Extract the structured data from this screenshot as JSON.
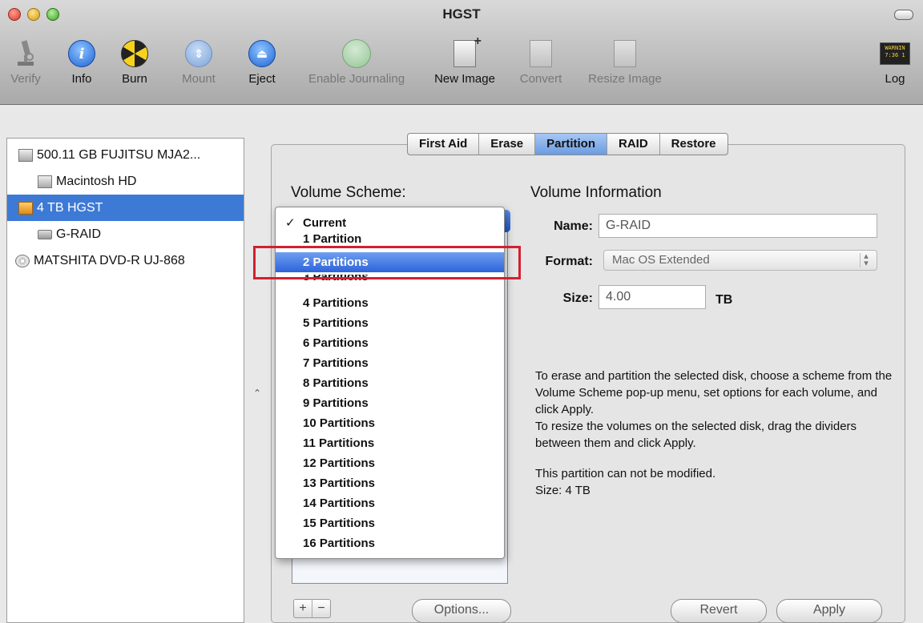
{
  "window": {
    "title": "HGST"
  },
  "toolbar": {
    "items": [
      {
        "label": "Verify",
        "icon": "microscope-icon",
        "enabled": false
      },
      {
        "label": "Info",
        "icon": "info-icon",
        "enabled": true
      },
      {
        "label": "Burn",
        "icon": "burn-icon",
        "enabled": true
      },
      {
        "label": "Mount",
        "icon": "mount-icon",
        "enabled": false
      },
      {
        "label": "Eject",
        "icon": "eject-icon",
        "enabled": true
      },
      {
        "label": "Enable Journaling",
        "icon": "journaling-icon",
        "enabled": false
      },
      {
        "label": "New Image",
        "icon": "new-image-icon",
        "enabled": true
      },
      {
        "label": "Convert",
        "icon": "convert-icon",
        "enabled": false
      },
      {
        "label": "Resize Image",
        "icon": "resize-image-icon",
        "enabled": false
      },
      {
        "label": "Log",
        "icon": "log-icon",
        "enabled": true
      }
    ],
    "log_icon_text": "WARNIN 7:36 1"
  },
  "sidebar": {
    "items": [
      {
        "label": "500.11 GB FUJITSU MJA2...",
        "level": 0,
        "selected": false,
        "icon": "hard-disk-icon"
      },
      {
        "label": "Macintosh HD",
        "level": 1,
        "selected": false,
        "icon": "volume-icon"
      },
      {
        "label": "4 TB HGST",
        "level": 0,
        "selected": true,
        "icon": "external-disk-icon"
      },
      {
        "label": "G-RAID",
        "level": 1,
        "selected": false,
        "icon": "volume-icon"
      },
      {
        "label": "MATSHITA DVD-R UJ-868",
        "level": 0,
        "selected": false,
        "icon": "dvd-icon"
      }
    ]
  },
  "tabs": {
    "items": [
      "First Aid",
      "Erase",
      "Partition",
      "RAID",
      "Restore"
    ],
    "active": "Partition"
  },
  "partition": {
    "volume_scheme_label": "Volume Scheme:",
    "volume_info_label": "Volume Information",
    "name_label": "Name:",
    "name_value": "G-RAID",
    "format_label": "Format:",
    "format_value": "Mac OS Extended",
    "size_label": "Size:",
    "size_value": "4.00",
    "size_unit": "TB",
    "info_text_1": "To erase and partition the selected disk, choose a scheme from the Volume Scheme pop-up menu, set options for each volume, and click Apply.",
    "info_text_2": "To resize the volumes on the selected disk, drag the dividers between them and click Apply.",
    "status_text_1": "This partition can not be modified.",
    "status_text_2": "Size: 4 TB",
    "add_label": "+",
    "remove_label": "−",
    "options_label": "Options...",
    "revert_label": "Revert",
    "apply_label": "Apply"
  },
  "scheme_menu": {
    "items": [
      "Current",
      "1 Partition",
      "2 Partitions",
      "3 Partitions",
      "4 Partitions",
      "5 Partitions",
      "6 Partitions",
      "7 Partitions",
      "8 Partitions",
      "9 Partitions",
      "10 Partitions",
      "11 Partitions",
      "12 Partitions",
      "13 Partitions",
      "14 Partitions",
      "15 Partitions",
      "16 Partitions"
    ],
    "checked": "Current",
    "highlighted": "2 Partitions",
    "check_mark": "✓"
  },
  "annotation": {
    "color": "#d22030"
  }
}
